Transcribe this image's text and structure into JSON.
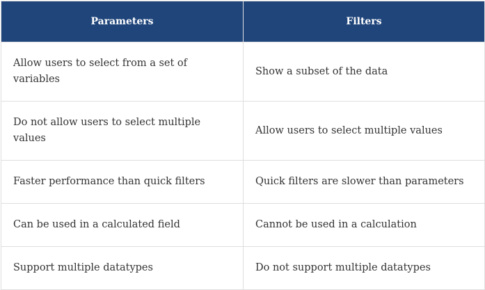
{
  "table": {
    "headers": [
      "Parameters",
      "Filters"
    ],
    "rows": [
      [
        "Allow users to select from a set of variables",
        "Show a subset of the data"
      ],
      [
        "Do not allow users to select multiple values",
        "Allow users to select multiple values"
      ],
      [
        "Faster performance than quick filters",
        "Quick filters are slower than parameters"
      ],
      [
        "Can be used in a calculated field",
        "Cannot be used in a calculation"
      ],
      [
        "Support multiple datatypes",
        "Do not support multiple datatypes"
      ]
    ]
  },
  "colors": {
    "header_background": "#1f457b",
    "header_text": "#ffffff",
    "body_text": "#333333",
    "border": "#dedede"
  }
}
